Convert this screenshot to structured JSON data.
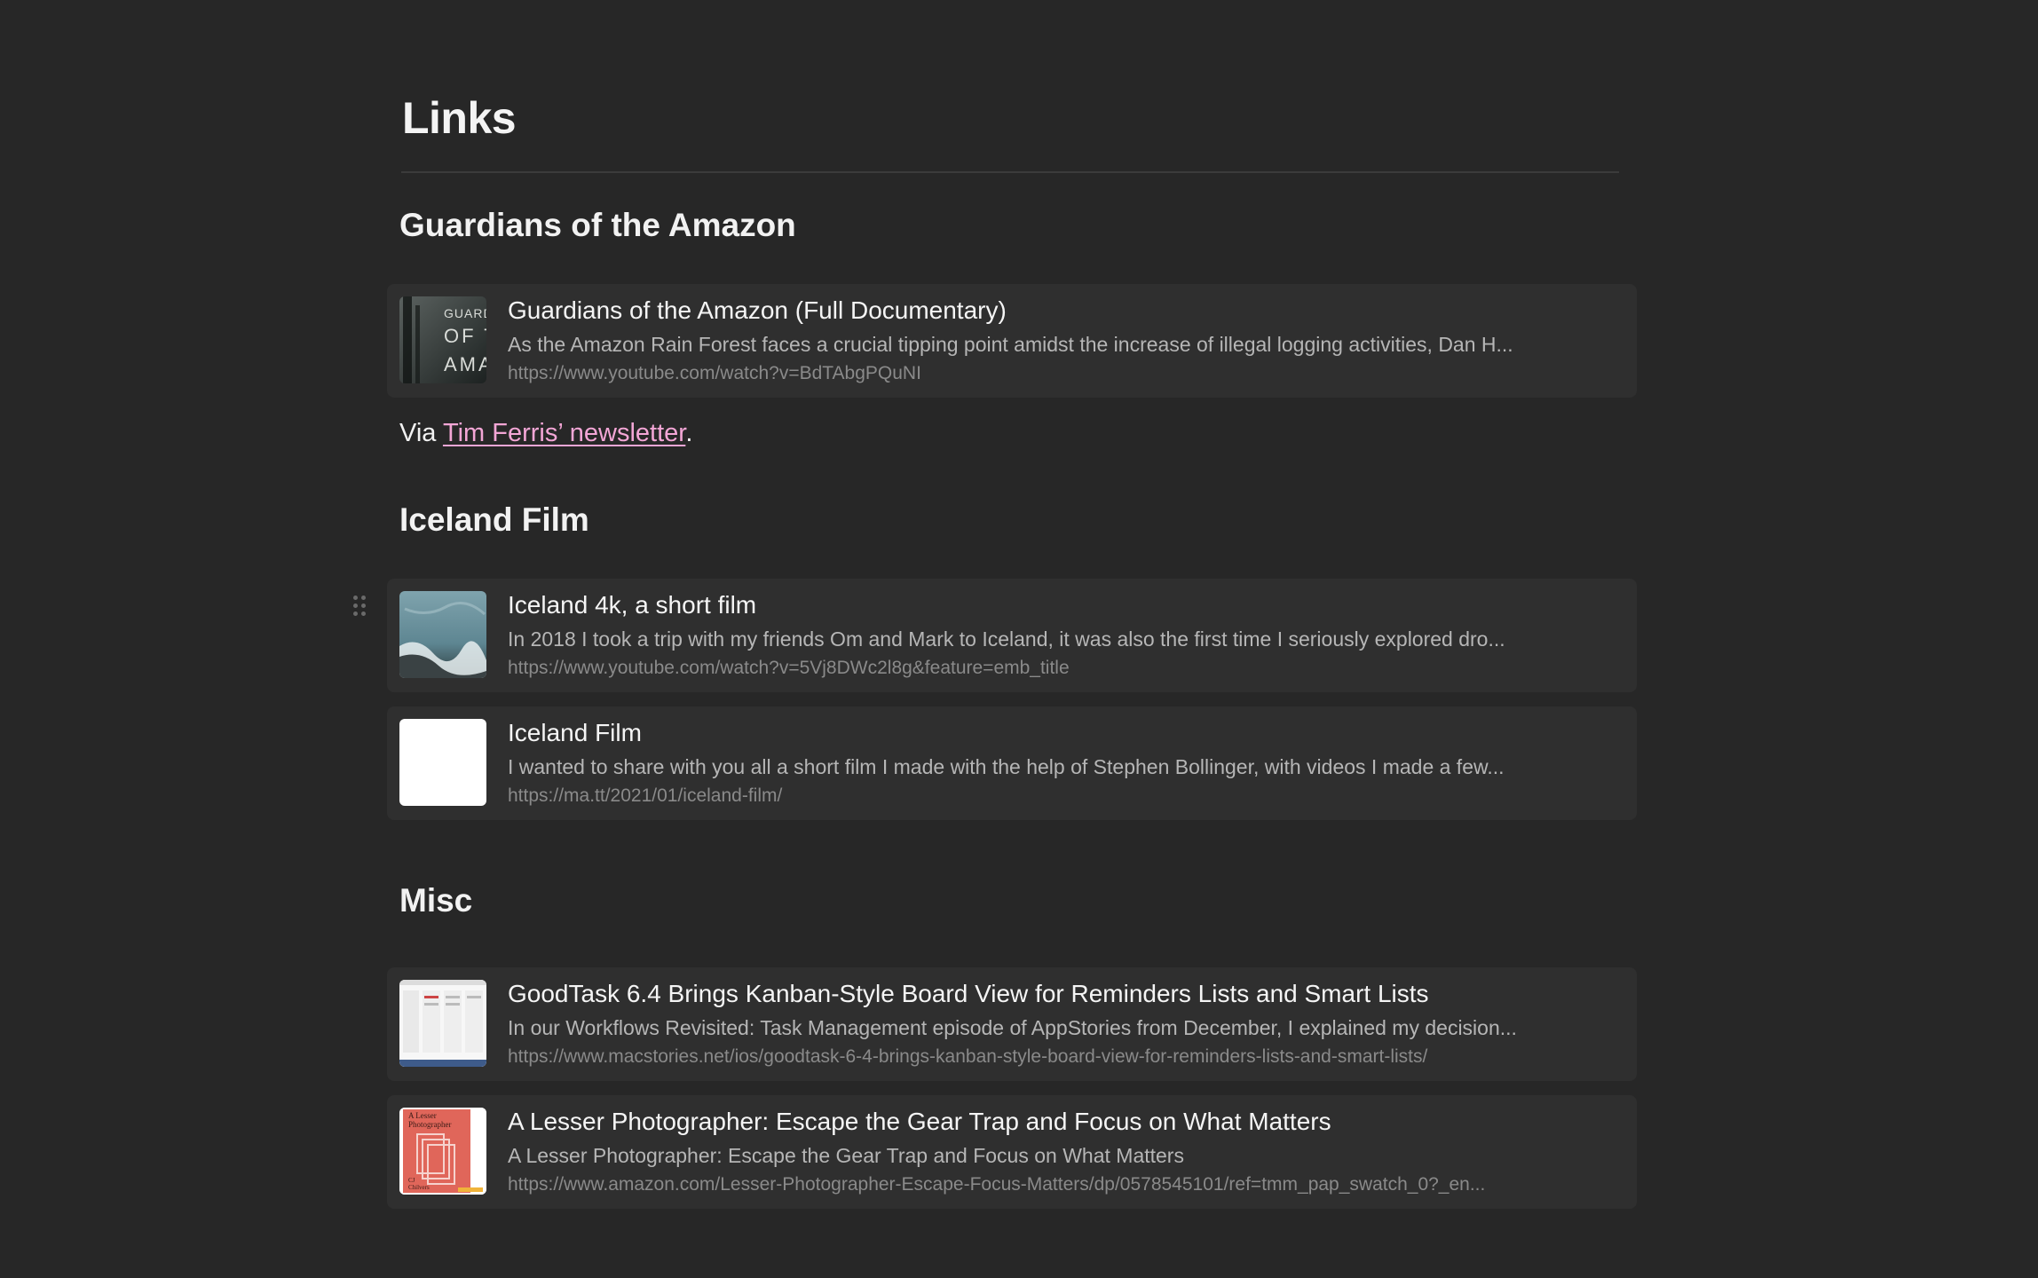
{
  "page": {
    "title": "Links"
  },
  "sections": [
    {
      "heading": "Guardians of the Amazon",
      "cards": [
        {
          "title": "Guardians of the Amazon (Full Documentary)",
          "description": "As the Amazon Rain Forest faces a crucial tipping point amidst the increase of illegal logging activities, Dan H...",
          "url": "https://www.youtube.com/watch?v=BdTAbgPQuNI",
          "thumbnail_text": [
            "GUARDI",
            "OF T",
            "AMAZ"
          ]
        }
      ],
      "note": {
        "prefix": "Via ",
        "link_text": "Tim Ferris’ newsletter",
        "suffix": "."
      }
    },
    {
      "heading": "Iceland Film",
      "cards": [
        {
          "title": "Iceland 4k, a short film",
          "description": "In 2018 I took a trip with my friends Om and Mark to Iceland, it was also the first time I seriously explored dro...",
          "url": "https://www.youtube.com/watch?v=5Vj8DWc2l8g&feature=emb_title"
        },
        {
          "title": "Iceland Film",
          "description": "I wanted to share with you all a short film I made with the help of Stephen Bollinger, with videos I made a few...",
          "url": "https://ma.tt/2021/01/iceland-film/"
        }
      ]
    },
    {
      "heading": "Misc",
      "cards": [
        {
          "title": "GoodTask 6.4 Brings Kanban-Style Board View for Reminders Lists and Smart Lists",
          "description": "In our Workflows Revisited: Task Management episode of AppStories from December, I explained my decision...",
          "url": "https://www.macstories.net/ios/goodtask-6-4-brings-kanban-style-board-view-for-reminders-lists-and-smart-lists/"
        },
        {
          "title": "A Lesser Photographer: Escape the Gear Trap and Focus on What Matters",
          "description": "A Lesser Photographer: Escape the Gear Trap and Focus on What Matters",
          "url": "https://www.amazon.com/Lesser-Photographer-Escape-Focus-Matters/dp/0578545101/ref=tmm_pap_swatch_0?_en...",
          "thumbnail_text": [
            "A Lesser",
            "Photographer",
            "CJ",
            "Chilvers"
          ]
        }
      ]
    }
  ],
  "colors": {
    "background": "#272727",
    "card": "#2f2f2f",
    "link": "#f3a6d6"
  },
  "icons": {
    "drag_handle": "drag-handle-icon"
  }
}
